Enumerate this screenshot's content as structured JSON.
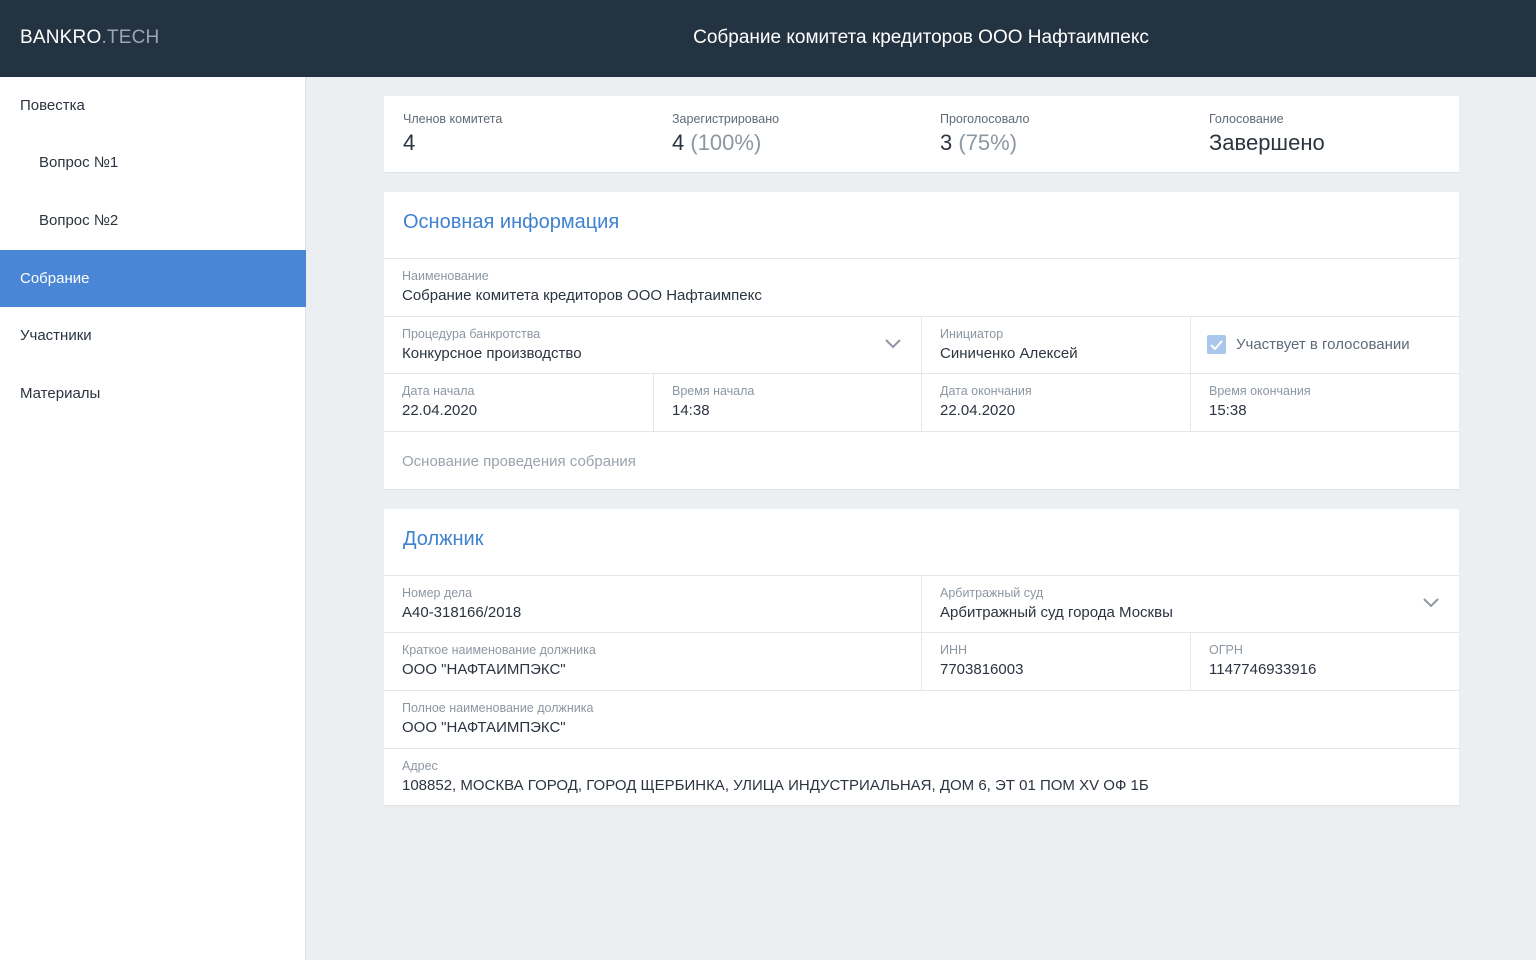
{
  "header": {
    "logo_main": "BANKRO",
    "logo_suffix": ".TECH",
    "title": "Собрание комитета кредиторов ООО Нафтаимпекс"
  },
  "sidebar": {
    "items": [
      {
        "label": "Повестка"
      },
      {
        "label": "Вопрос №1"
      },
      {
        "label": "Вопрос №2"
      },
      {
        "label": "Собрание"
      },
      {
        "label": "Участники"
      },
      {
        "label": "Материалы"
      }
    ],
    "active": "Собрание"
  },
  "stats": {
    "members": {
      "label": "Членов комитета",
      "value": "4"
    },
    "registered": {
      "label": "Зарегистрировано",
      "value": "4",
      "pct": "(100%)"
    },
    "voted": {
      "label": "Проголосовало",
      "value": "3",
      "pct": "(75%)"
    },
    "voting": {
      "label": "Голосование",
      "value": "Завершено"
    }
  },
  "main_info": {
    "title": "Основная информация",
    "name": {
      "label": "Наименование",
      "value": "Собрание комитета кредиторов ООО Нафтаимпекс"
    },
    "procedure": {
      "label": "Процедура банкротства",
      "value": "Конкурсное производство"
    },
    "initiator": {
      "label": "Инициатор",
      "value": "Синиченко Алексей"
    },
    "votes_checkbox": {
      "label": "Участвует в голосовании",
      "checked": true
    },
    "start_date": {
      "label": "Дата начала",
      "value": "22.04.2020"
    },
    "start_time": {
      "label": "Время начала",
      "value": "14:38"
    },
    "end_date": {
      "label": "Дата окончания",
      "value": "22.04.2020"
    },
    "end_time": {
      "label": "Время окончания",
      "value": "15:38"
    },
    "basis": {
      "placeholder": "Основание проведения собрания"
    }
  },
  "debtor": {
    "title": "Должник",
    "case_number": {
      "label": "Номер дела",
      "value": "А40-318166/2018"
    },
    "court": {
      "label": "Арбитражный суд",
      "value": "Арбитражный суд города Москвы"
    },
    "short_name": {
      "label": "Краткое наименование должника",
      "value": "ООО \"НАФТАИМПЭКС\""
    },
    "inn": {
      "label": "ИНН",
      "value": "7703816003"
    },
    "ogrn": {
      "label": "ОГРН",
      "value": "1147746933916"
    },
    "full_name": {
      "label": "Полное наименование должника",
      "value": "ООО \"НАФТАИМПЭКС\""
    },
    "address": {
      "label": "Адрес",
      "value": "108852, МОСКВА ГОРОД, ГОРОД ЩЕРБИНКА, УЛИЦА ИНДУСТРИАЛЬНАЯ, ДОМ 6, ЭТ 01 ПОМ XV ОФ 1Б"
    }
  },
  "colors": {
    "topbar": "#243342",
    "accent": "#4a86d6",
    "section_title": "#3f82cf",
    "background": "#eceff1"
  }
}
